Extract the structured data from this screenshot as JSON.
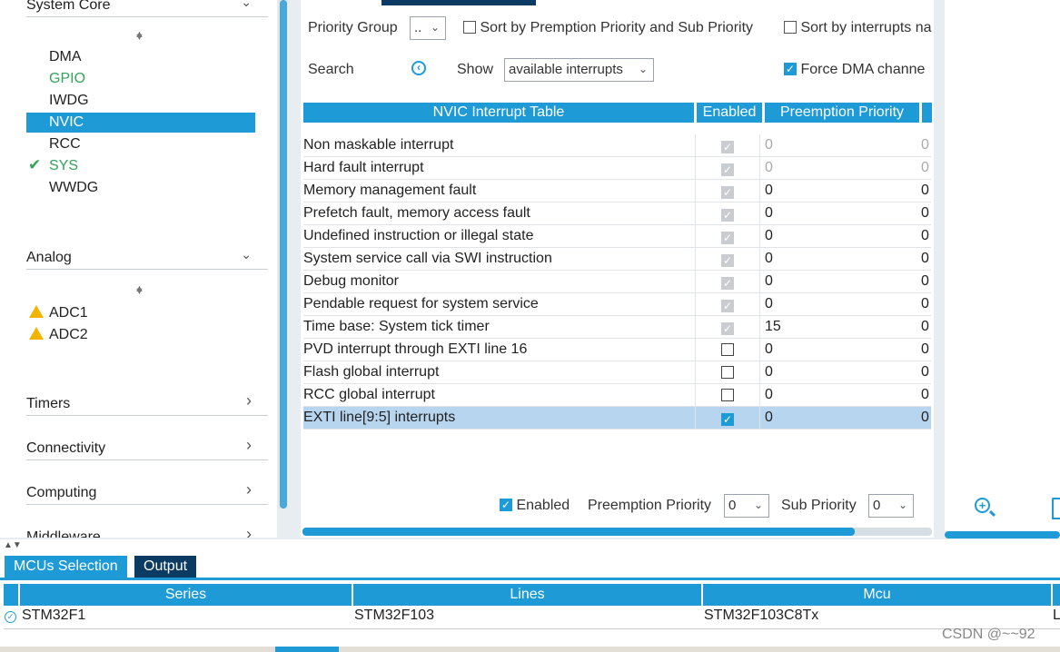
{
  "sidebar": {
    "system_core": {
      "label": "System Core",
      "items": [
        "DMA",
        "GPIO",
        "IWDG",
        "NVIC",
        "RCC",
        "SYS",
        "WWDG"
      ]
    },
    "analog": {
      "label": "Analog",
      "items": [
        "ADC1",
        "ADC2"
      ]
    },
    "timers": "Timers",
    "connectivity": "Connectivity",
    "computing": "Computing",
    "middleware": "Middleware"
  },
  "config": {
    "priority_group_label": "Priority Group",
    "priority_group_value": "..",
    "sort_premption": "Sort by Premption Priority and Sub Priority",
    "sort_interrupts": "Sort by interrupts na",
    "search_label": "Search",
    "show_label": "Show",
    "show_value": "available interrupts",
    "force_dma": "Force DMA channe"
  },
  "table": {
    "headers": {
      "name": "NVIC Interrupt Table",
      "enabled": "Enabled",
      "preemption": "Preemption Priority"
    },
    "rows": [
      {
        "name": "Non maskable interrupt",
        "enabled": "locked",
        "preemption": "0",
        "sub": "0",
        "disabled": true
      },
      {
        "name": "Hard fault interrupt",
        "enabled": "locked",
        "preemption": "0",
        "sub": "0",
        "disabled": true
      },
      {
        "name": "Memory management fault",
        "enabled": "locked",
        "preemption": "0",
        "sub": "0",
        "disabled": false
      },
      {
        "name": "Prefetch fault, memory access fault",
        "enabled": "locked",
        "preemption": "0",
        "sub": "0",
        "disabled": false
      },
      {
        "name": "Undefined instruction or illegal state",
        "enabled": "locked",
        "preemption": "0",
        "sub": "0",
        "disabled": false
      },
      {
        "name": "System service call via SWI instruction",
        "enabled": "locked",
        "preemption": "0",
        "sub": "0",
        "disabled": false
      },
      {
        "name": "Debug monitor",
        "enabled": "locked",
        "preemption": "0",
        "sub": "0",
        "disabled": false
      },
      {
        "name": "Pendable request for system service",
        "enabled": "locked",
        "preemption": "0",
        "sub": "0",
        "disabled": false
      },
      {
        "name": "Time base: System tick timer",
        "enabled": "locked",
        "preemption": "15",
        "sub": "0",
        "disabled": false
      },
      {
        "name": "PVD interrupt through EXTI line 16",
        "enabled": "off",
        "preemption": "0",
        "sub": "0",
        "disabled": false
      },
      {
        "name": "Flash global interrupt",
        "enabled": "off",
        "preemption": "0",
        "sub": "0",
        "disabled": false
      },
      {
        "name": "RCC global interrupt",
        "enabled": "off",
        "preemption": "0",
        "sub": "0",
        "disabled": false
      },
      {
        "name": "EXTI line[9:5] interrupts",
        "enabled": "on",
        "preemption": "0",
        "sub": "0",
        "disabled": false
      }
    ]
  },
  "footer_controls": {
    "enabled_label": "Enabled",
    "preemption_label": "Preemption Priority",
    "preemption_value": "0",
    "sub_label": "Sub Priority",
    "sub_value": "0"
  },
  "bottom": {
    "tabs": [
      "MCUs Selection",
      "Output"
    ],
    "headers": [
      "Series",
      "Lines",
      "Mcu"
    ],
    "row": [
      "STM32F1",
      "STM32F103",
      "STM32F103C8Tx",
      "L"
    ]
  },
  "watermark": "CSDN @~~92",
  "colors": {
    "accent": "#1e9bd7",
    "green": "#33a35a",
    "warning": "#f0b400",
    "dark_tab": "#0b3a63"
  }
}
